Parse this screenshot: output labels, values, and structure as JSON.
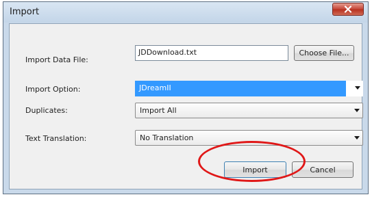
{
  "dialog": {
    "title": "Import",
    "close_label": "X"
  },
  "form": {
    "import_data_file": {
      "label": "Import Data File:",
      "value": "JDDownload.txt",
      "choose_button": "Choose File..."
    },
    "import_option": {
      "label": "Import Option:",
      "selected": "JDreamII"
    },
    "duplicates": {
      "label": "Duplicates:",
      "selected": "Import All"
    },
    "text_translation": {
      "label": "Text Translation:",
      "selected": "No Translation"
    }
  },
  "actions": {
    "import_label": "Import",
    "cancel_label": "Cancel"
  },
  "colors": {
    "selection_highlight": "#3399ff",
    "annotation_circle": "#e01818",
    "close_button": "#c6483a"
  }
}
